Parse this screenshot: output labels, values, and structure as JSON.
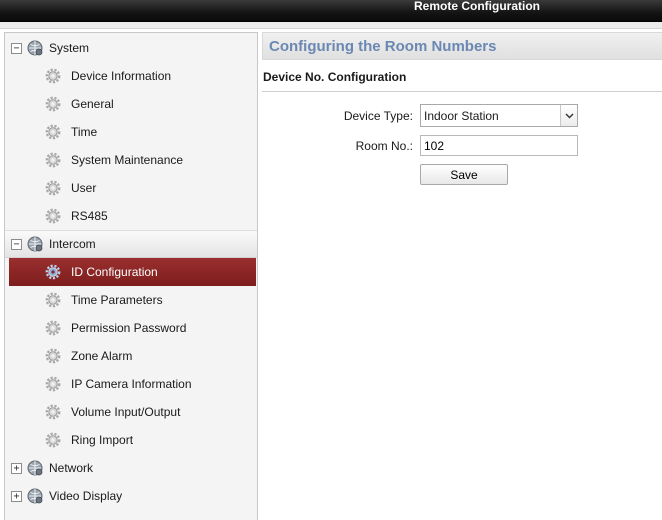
{
  "window": {
    "title": "Remote Configuration"
  },
  "sidebar": {
    "groups": [
      {
        "label": "System",
        "expanded": true,
        "toggle": "−",
        "items": [
          "Device Information",
          "General",
          "Time",
          "System Maintenance",
          "User",
          "RS485"
        ]
      },
      {
        "label": "Intercom",
        "expanded": true,
        "toggle": "−",
        "items": [
          "ID Configuration",
          "Time Parameters",
          "Permission Password",
          "Zone Alarm",
          "IP Camera Information",
          "Volume Input/Output",
          "Ring Import"
        ]
      },
      {
        "label": "Network",
        "expanded": false,
        "toggle": "+",
        "items": []
      },
      {
        "label": "Video Display",
        "expanded": false,
        "toggle": "+",
        "items": []
      }
    ],
    "selected_item": "ID Configuration",
    "icons": {
      "group": "globe-icon",
      "item": "gear-icon"
    },
    "colors": {
      "selected_bg": "#8b2626",
      "selected_text": "#ffffff"
    }
  },
  "main": {
    "heading": "Configuring the Room Numbers",
    "section_title": "Device No. Configuration",
    "form": {
      "device_type_label": "Device Type:",
      "device_type_value": "Indoor Station",
      "room_no_label": "Room No.:",
      "room_no_value": "102",
      "save_label": "Save"
    },
    "colors": {
      "heading": "#6b88b3"
    }
  }
}
